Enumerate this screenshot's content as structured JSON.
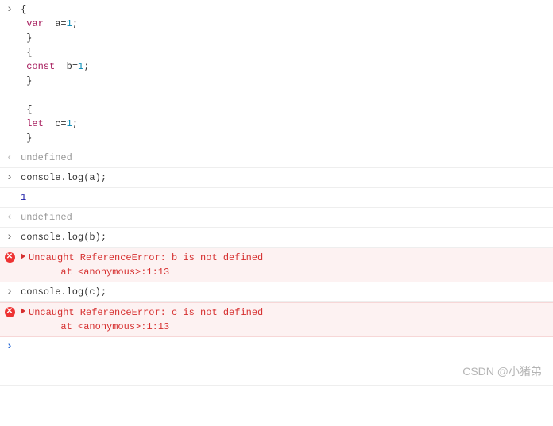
{
  "entries": [
    {
      "kind": "input",
      "tokens": [
        {
          "t": "{",
          "c": ""
        },
        {
          "t": "\n ",
          "c": ""
        },
        {
          "t": "var",
          "c": "kw"
        },
        {
          "t": "  a=",
          "c": ""
        },
        {
          "t": "1",
          "c": "nm"
        },
        {
          "t": ";",
          "c": ""
        },
        {
          "t": "\n }",
          "c": ""
        },
        {
          "t": "\n {",
          "c": ""
        },
        {
          "t": "\n ",
          "c": ""
        },
        {
          "t": "const",
          "c": "kw"
        },
        {
          "t": "  b=",
          "c": ""
        },
        {
          "t": "1",
          "c": "nm"
        },
        {
          "t": ";",
          "c": ""
        },
        {
          "t": "\n }",
          "c": ""
        },
        {
          "t": "\n",
          "c": ""
        },
        {
          "t": "\n {",
          "c": ""
        },
        {
          "t": "\n ",
          "c": ""
        },
        {
          "t": "let",
          "c": "kw"
        },
        {
          "t": "  c=",
          "c": ""
        },
        {
          "t": "1",
          "c": "nm"
        },
        {
          "t": ";",
          "c": ""
        },
        {
          "t": "\n }",
          "c": ""
        }
      ]
    },
    {
      "kind": "result",
      "text": "undefined"
    },
    {
      "kind": "input",
      "tokens": [
        {
          "t": "console.log(a);",
          "c": ""
        }
      ]
    },
    {
      "kind": "log",
      "text": "1"
    },
    {
      "kind": "result",
      "text": "undefined"
    },
    {
      "kind": "input",
      "tokens": [
        {
          "t": "console.log(b);",
          "c": ""
        }
      ]
    },
    {
      "kind": "error",
      "message": "Uncaught ReferenceError: b is not defined",
      "at": "at <anonymous>:1:13"
    },
    {
      "kind": "input",
      "tokens": [
        {
          "t": "console.log(c);",
          "c": ""
        }
      ]
    },
    {
      "kind": "error",
      "message": "Uncaught ReferenceError: c is not defined",
      "at": "at <anonymous>:1:13"
    }
  ],
  "prompt": {
    "value": ""
  },
  "watermark": "CSDN @小猪弟"
}
